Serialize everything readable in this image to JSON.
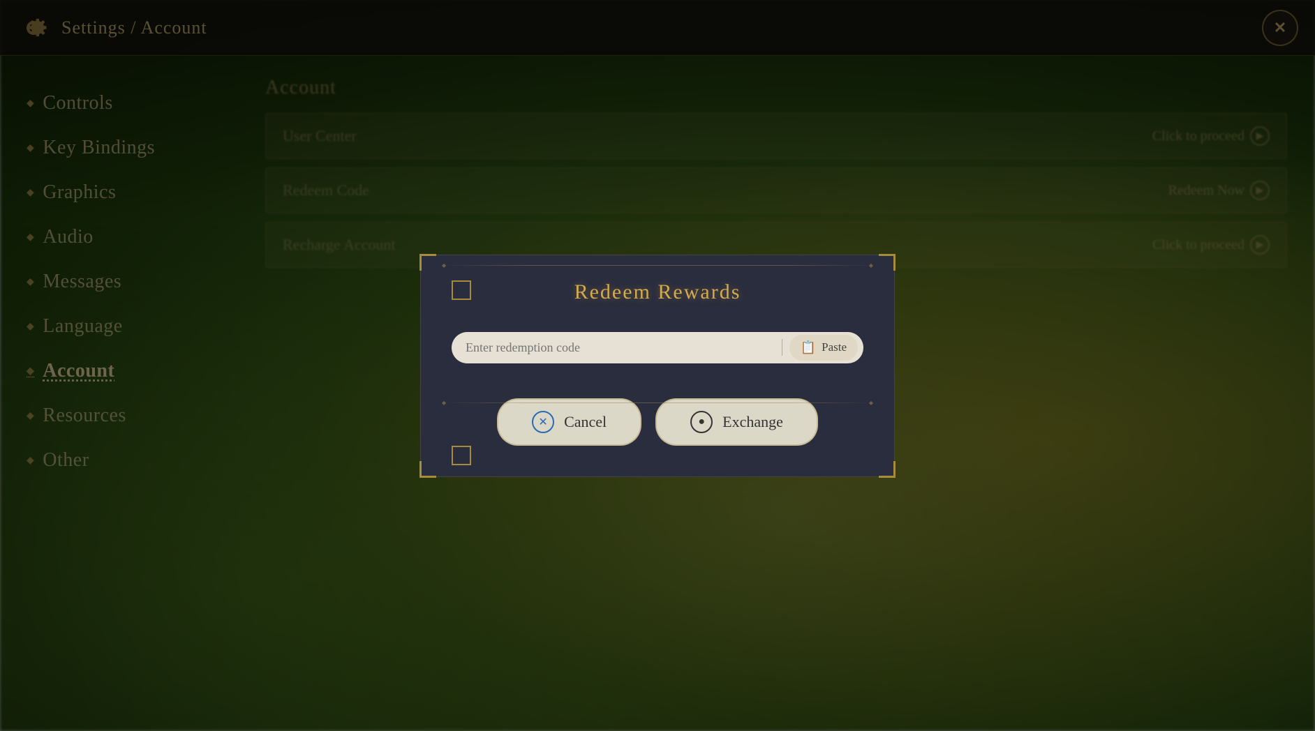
{
  "header": {
    "title": "Settings / Account",
    "close_label": "✕"
  },
  "sidebar": {
    "items": [
      {
        "id": "controls",
        "label": "Controls",
        "active": false
      },
      {
        "id": "key-bindings",
        "label": "Key Bindings",
        "active": false
      },
      {
        "id": "graphics",
        "label": "Graphics",
        "active": false
      },
      {
        "id": "audio",
        "label": "Audio",
        "active": false
      },
      {
        "id": "messages",
        "label": "Messages",
        "active": false
      },
      {
        "id": "language",
        "label": "Language",
        "active": false
      },
      {
        "id": "account",
        "label": "Account",
        "active": true
      },
      {
        "id": "resources",
        "label": "Resources",
        "active": false
      },
      {
        "id": "other",
        "label": "Other",
        "active": false
      }
    ]
  },
  "account_section": {
    "title": "Account",
    "rows": [
      {
        "label": "User Center",
        "action": "Click to proceed"
      },
      {
        "label": "Redeem Code",
        "action": "Redeem Now"
      },
      {
        "label": "Recharge Account",
        "action": "Click to proceed"
      }
    ]
  },
  "modal": {
    "title": "Redeem Rewards",
    "input_placeholder": "Enter redemption code",
    "paste_label": "Paste",
    "cancel_label": "Cancel",
    "exchange_label": "Exchange",
    "cancel_icon": "✕",
    "exchange_icon": "○"
  }
}
